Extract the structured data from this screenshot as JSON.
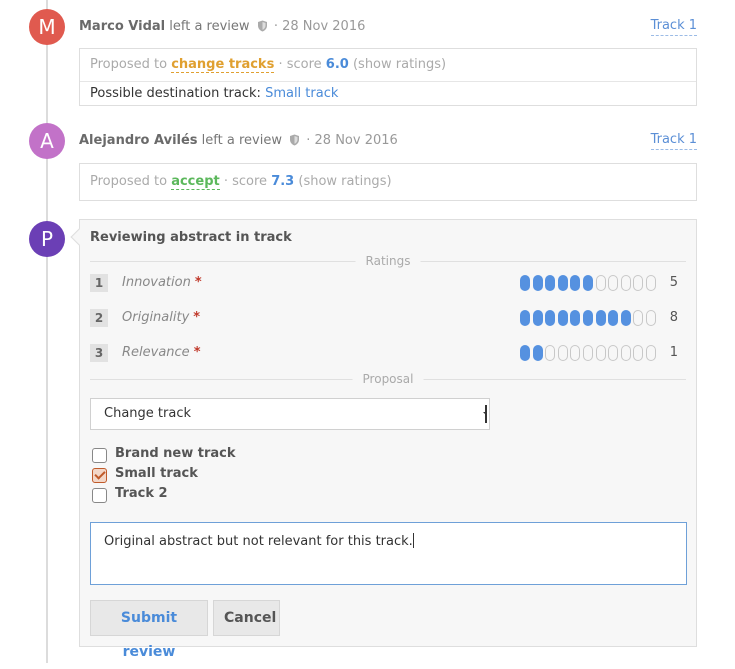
{
  "entries": [
    {
      "avatar_letter": "M",
      "avatar_color": "#e05a4f",
      "author": "Marco Vidal",
      "action": "left a review",
      "separator": "·",
      "date": "28 Nov 2016",
      "track_label": "Track 1",
      "proposed_prefix": "Proposed to",
      "proposal": "change tracks",
      "score_label": "· score",
      "score": "6.0",
      "show_ratings": "(show ratings)",
      "destination_label": "Possible destination track:",
      "destination": "Small track"
    },
    {
      "avatar_letter": "A",
      "avatar_color": "#c272c8",
      "author": "Alejandro Avilés",
      "action": "left a review",
      "separator": "·",
      "date": "28 Nov 2016",
      "track_label": "Track 1",
      "proposed_prefix": "Proposed to",
      "proposal": "accept",
      "score_label": "· score",
      "score": "7.3",
      "show_ratings": "(show ratings)"
    }
  ],
  "reviewer": {
    "avatar_letter": "P",
    "avatar_color": "#6b3fb5"
  },
  "form": {
    "title": "Reviewing abstract in track",
    "ratings_label": "Ratings",
    "ratings": [
      {
        "num": "1",
        "name": "Innovation",
        "required": "*",
        "value": "5",
        "filled": 6,
        "total": 11
      },
      {
        "num": "2",
        "name": "Originality",
        "required": "*",
        "value": "8",
        "filled": 9,
        "total": 11
      },
      {
        "num": "3",
        "name": "Relevance",
        "required": "*",
        "value": "1",
        "filled": 2,
        "total": 11
      }
    ],
    "proposal_label": "Proposal",
    "proposal_selected": "Change track",
    "tracks": [
      {
        "label": "Brand new track",
        "checked": false
      },
      {
        "label": "Small track",
        "checked": true
      },
      {
        "label": "Track 2",
        "checked": false
      }
    ],
    "comment": "Original abstract but not relevant for this track.",
    "submit_label": "Submit review",
    "cancel_label": "Cancel"
  },
  "colors": {
    "accent": "#4a8bd9",
    "warn": "#e0a030",
    "ok": "#5cb85c",
    "pip": "#5591e0"
  }
}
